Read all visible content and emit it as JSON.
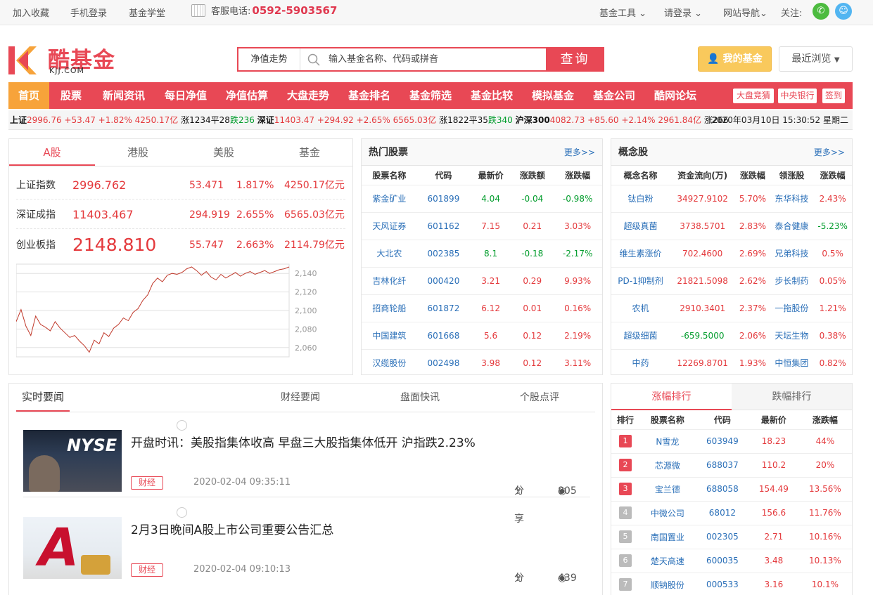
{
  "topbar": {
    "fav": "加入收藏",
    "mobile": "手机登录",
    "school": "基金学堂",
    "phone_label": "客服电话:",
    "phone": "0592-5903567",
    "tools": "基金工具",
    "login": "请登录",
    "sitenav": "网站导航",
    "follow": "关注:"
  },
  "logo": {
    "brand": "酷基金",
    "domain": "KJJ.COM"
  },
  "search": {
    "select": "净值走势",
    "placeholder": "输入基金名称、代码或拼音",
    "button": "查询"
  },
  "myfund": "我的基金",
  "recent": "最近浏览",
  "nav": {
    "items": [
      "首页",
      "股票",
      "新闻资讯",
      "每日净值",
      "净值估算",
      "大盘走势",
      "基金排名",
      "基金筛选",
      "基金比较",
      "模拟基金",
      "基金公司",
      "酷网论坛"
    ],
    "tags": [
      "大盘竞猜",
      "中央银行",
      "签到"
    ]
  },
  "ticker": {
    "sh_name": "上证",
    "sh": "2996.76 +53.47 +1.82% 4250.17亿",
    "sh_up": "涨1234",
    "sh_flat": "平28",
    "sh_down": "跌236",
    "sz_name": "深证",
    "sz": "11403.47 +294.92 +2.65% 6565.03亿",
    "sz_up": "涨1822",
    "sz_flat": "平35",
    "sz_down": "跌340",
    "hs_name": "沪深300",
    "hs": "4082.73 +85.60 +2.14% 2961.84亿",
    "hs_up": "涨266",
    "datetime": "2020年03月10日  15:30:52 星期二"
  },
  "market_tabs": [
    "A股",
    "港股",
    "美股",
    "基金"
  ],
  "indices": [
    {
      "name": "上证指数",
      "value": "2996.762",
      "chg": "53.471",
      "pct": "1.817%",
      "amt": "4250.17亿元"
    },
    {
      "name": "深证成指",
      "value": "11403.467",
      "chg": "294.919",
      "pct": "2.655%",
      "amt": "6565.03亿元"
    },
    {
      "name": "创业板指",
      "value": "2148.810",
      "chg": "55.747",
      "pct": "2.663%",
      "amt": "2114.79亿元"
    }
  ],
  "chart_data": {
    "type": "line",
    "title": "",
    "xlabel": "",
    "ylabel": "",
    "ylim": [
      2050,
      2150
    ],
    "yticks": [
      2060,
      2080,
      2100,
      2120,
      2140
    ],
    "series": [
      {
        "values": [
          2088,
          2101,
          2083,
          2073,
          2094,
          2085,
          2082,
          2078,
          2088,
          2081,
          2076,
          2071,
          2073,
          2067,
          2062,
          2055,
          2068,
          2064,
          2076,
          2072,
          2081,
          2085,
          2092,
          2089,
          2098,
          2102,
          2111,
          2117,
          2129,
          2135,
          2131,
          2138,
          2140,
          2139,
          2141,
          2145,
          2147,
          2143,
          2138,
          2142,
          2136,
          2133,
          2139,
          2135,
          2138,
          2141,
          2137,
          2140,
          2142,
          2139,
          2141,
          2143,
          2140,
          2142,
          2144,
          2145,
          2147
        ]
      }
    ]
  },
  "hot_stocks": {
    "title": "热门股票",
    "more": "更多>>",
    "headers": [
      "股票名称",
      "代码",
      "最新价",
      "涨跌额",
      "涨跌幅"
    ],
    "rows": [
      [
        "紫金矿业",
        "601899",
        "4.04",
        "-0.04",
        "-0.98%"
      ],
      [
        "天风证券",
        "601162",
        "7.15",
        "0.21",
        "3.03%"
      ],
      [
        "大北农",
        "002385",
        "8.1",
        "-0.18",
        "-2.17%"
      ],
      [
        "吉林化纤",
        "000420",
        "3.21",
        "0.29",
        "9.93%"
      ],
      [
        "招商轮船",
        "601872",
        "6.12",
        "0.01",
        "0.16%"
      ],
      [
        "中国建筑",
        "601668",
        "5.6",
        "0.12",
        "2.19%"
      ],
      [
        "汉缆股份",
        "002498",
        "3.98",
        "0.12",
        "3.11%"
      ]
    ]
  },
  "concepts": {
    "title": "概念股",
    "more": "更多>>",
    "headers": [
      "概念名称",
      "资金流向(万)",
      "涨跌幅",
      "领涨股",
      "涨跌幅"
    ],
    "rows": [
      [
        "钛白粉",
        "34927.9102",
        "5.70%",
        "东华科技",
        "2.43%"
      ],
      [
        "超级真菌",
        "3738.5701",
        "2.83%",
        "泰合健康",
        "-5.23%"
      ],
      [
        "维生素涨价",
        "702.4600",
        "2.69%",
        "兄弟科技",
        "0.5%"
      ],
      [
        "PD-1抑制剂",
        "21821.5098",
        "2.62%",
        "步长制药",
        "0.05%"
      ],
      [
        "农机",
        "2910.3401",
        "2.37%",
        "一拖股份",
        "1.21%"
      ],
      [
        "超级细菌",
        "-659.5000",
        "2.06%",
        "天坛生物",
        "0.38%"
      ],
      [
        "中药",
        "12269.8701",
        "1.93%",
        "中恒集团",
        "0.82%"
      ]
    ]
  },
  "news": {
    "tabs": [
      "实时要闻",
      "财经要闻",
      "盘面快讯",
      "个股点评"
    ],
    "items": [
      {
        "title": "开盘时讯：美股指集体收高 早盘三大股指集体低开 沪指跌2.23%",
        "tag": "财经",
        "time": "2020-02-04 09:35:11",
        "share": "分享",
        "views": "805"
      },
      {
        "title": "2月3日晚间A股上市公司重要公告汇总",
        "tag": "财经",
        "time": "2020-02-04 09:10:13",
        "share": "分享",
        "views": "439"
      }
    ]
  },
  "rank": {
    "tabs": [
      "涨幅排行",
      "跌幅排行"
    ],
    "headers": [
      "排行",
      "股票名称",
      "代码",
      "最新价",
      "涨跌幅"
    ],
    "rows": [
      [
        "1",
        "N雪龙",
        "603949",
        "18.23",
        "44%"
      ],
      [
        "2",
        "芯源微",
        "688037",
        "110.2",
        "20%"
      ],
      [
        "3",
        "宝兰德",
        "688058",
        "154.49",
        "13.56%"
      ],
      [
        "4",
        "中微公司",
        "68012",
        "156.6",
        "11.76%"
      ],
      [
        "5",
        "南国置业",
        "002305",
        "2.71",
        "10.16%"
      ],
      [
        "6",
        "楚天高速",
        "600035",
        "3.48",
        "10.13%"
      ],
      [
        "7",
        "顺钠股份",
        "000533",
        "3.16",
        "10.1%"
      ]
    ]
  }
}
